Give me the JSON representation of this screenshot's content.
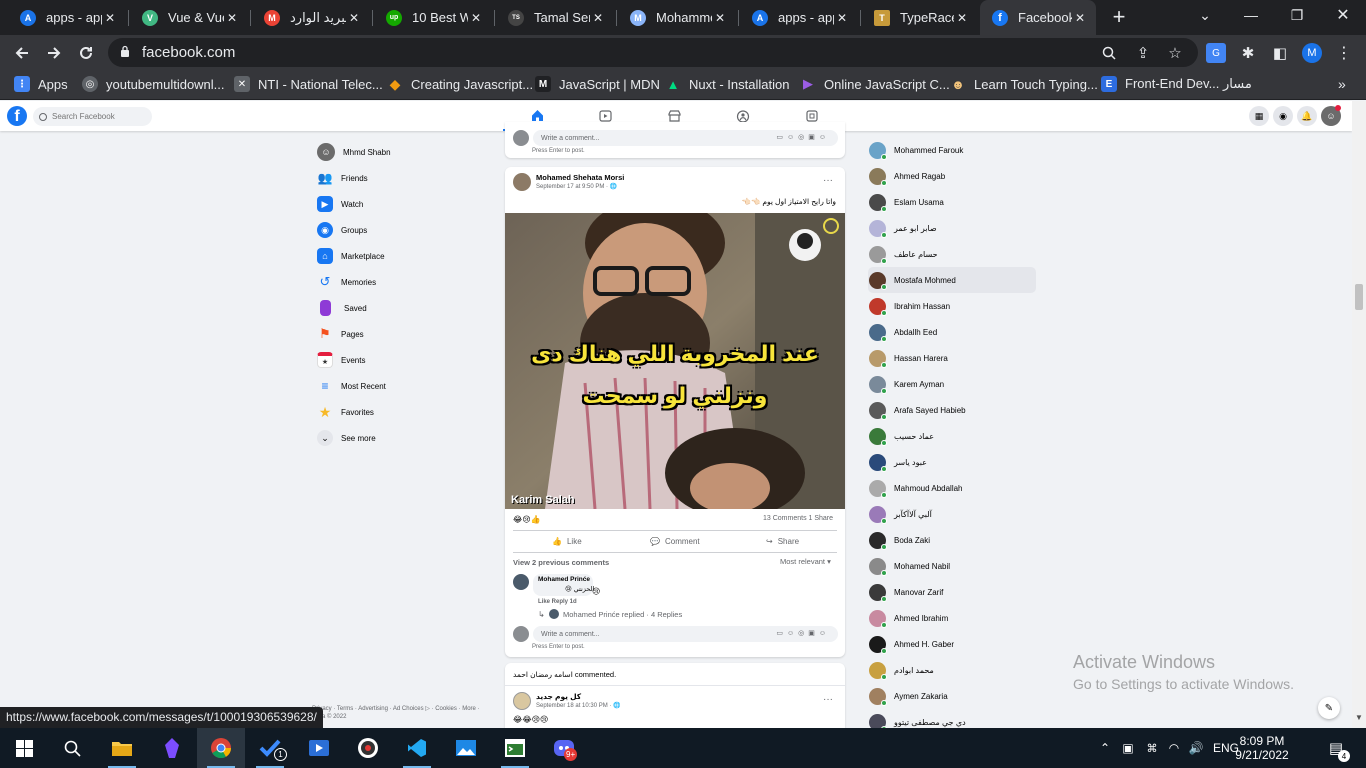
{
  "browser": {
    "tabs": [
      {
        "title": "apps - app",
        "color": "#1a73e8",
        "glyph": "A"
      },
      {
        "title": "Vue & Vue",
        "color": "#41b883",
        "glyph": "V"
      },
      {
        "title": "البريد الوارد",
        "color": "#ea4335",
        "glyph": "M"
      },
      {
        "title": "10 Best We",
        "color": "#14a800",
        "glyph": "up"
      },
      {
        "title": "Tamal Sen",
        "color": "#444444",
        "glyph": "TS"
      },
      {
        "title": "Mohamme",
        "color": "#8ab4f8",
        "glyph": "M"
      },
      {
        "title": "apps - app",
        "color": "#1a73e8",
        "glyph": "A"
      },
      {
        "title": "TypeRacer",
        "color": "#c79a3a",
        "glyph": "T"
      },
      {
        "title": "Facebook",
        "color": "#1877f2",
        "glyph": "f"
      }
    ],
    "url": "facebook.com",
    "profile_initial": "M",
    "bookmarks": [
      {
        "label": "Apps",
        "color": "#4285f4",
        "glyph": "⋮"
      },
      {
        "label": "youtubemultidownl...",
        "color": "#5f6368",
        "glyph": "◎"
      },
      {
        "label": "NTI - National Telec...",
        "color": "#5f6368",
        "glyph": "✕"
      },
      {
        "label": "Creating Javascript...",
        "color": "#f29b11",
        "glyph": "◆"
      },
      {
        "label": "JavaScript | MDN",
        "color": "#202124",
        "glyph": "M"
      },
      {
        "label": "Nuxt - Installation",
        "color": "#00dc82",
        "glyph": "▲"
      },
      {
        "label": "Online JavaScript C...",
        "color": "#7b2cbf",
        "glyph": "▶"
      },
      {
        "label": "Learn Touch Typing...",
        "color": "#d9534f",
        "glyph": "☻"
      },
      {
        "label": "Front-End Dev... مسار",
        "color": "#2d6cdf",
        "glyph": "E"
      }
    ],
    "status_url": "https://www.facebook.com/messages/t/100019306539628/"
  },
  "facebook": {
    "search_placeholder": "Search Facebook",
    "left_nav": [
      {
        "label": "Mhmd Shabn",
        "color": "#6b6b6b",
        "glyph": "☺",
        "round": true
      },
      {
        "label": "Friends",
        "color": "#1877f2",
        "glyph": "👥"
      },
      {
        "label": "Watch",
        "color": "#1877f2",
        "glyph": "▶"
      },
      {
        "label": "Groups",
        "color": "#1877f2",
        "glyph": "◉"
      },
      {
        "label": "Marketplace",
        "color": "#1877f2",
        "glyph": "⌂"
      },
      {
        "label": "Memories",
        "color": "#1877f2",
        "glyph": "↺"
      },
      {
        "label": "Saved",
        "color": "#8e3ad6",
        "glyph": "▮"
      },
      {
        "label": "Pages",
        "color": "#f4511e",
        "glyph": "⚑"
      },
      {
        "label": "Events",
        "color": "#e4e6eb",
        "glyph": "★"
      },
      {
        "label": "Most Recent",
        "color": "#1877f2",
        "glyph": "≡"
      },
      {
        "label": "Favorites",
        "color": "#f7b928",
        "glyph": "★"
      },
      {
        "label": "See more",
        "color": "#e4e6eb",
        "glyph": "⌄"
      }
    ],
    "footer": "Privacy · Terms · Advertising · Ad Choices ▷ · Cookies · More · Meta © 2022",
    "top_comment_placeholder": "Write a comment...",
    "press_enter": "Press Enter to post.",
    "post": {
      "author": "Mohamed Shehata Morsi",
      "time": "September 17 at 9:50 PM · 🌐",
      "text": "واتا رايح الامتياز اول يوم 👈🏻👈🏻",
      "meme_line1": "عند المخروبة اللي هناك دى",
      "meme_line2": "ونزلني لو سمحت",
      "watermark": "Karim Salah",
      "reactions": "😂😢👍",
      "counts": "13 Comments  1 Share",
      "like": "Like",
      "comment": "Comment",
      "share": "Share",
      "view_prev": "View 2 previous comments",
      "most_relevant": "Most relevant ▾",
      "reply_author": "Mohamed Prinće",
      "reply_text": "الحزنتي 😢",
      "reply_react": "😢",
      "reply_actions": "Like  Reply  1d",
      "replied": "Mohamed Prinće replied · 4 Replies",
      "comment_placeholder": "Write a comment..."
    },
    "next_post": {
      "commented": "اسامه رمضان احمد commented.",
      "title": "كل يوم جديد",
      "time": "September 18 at 10:30 PM · 🌐",
      "emojis": "😂😂😢😢"
    },
    "contacts": [
      {
        "name": "Mohammed Farouk",
        "color": "#6aa3c8"
      },
      {
        "name": "Ahmed Ragab",
        "color": "#8a7a5a"
      },
      {
        "name": "Eslam Usama",
        "color": "#4a4a4a"
      },
      {
        "name": "صابر ابو عمر",
        "color": "#b4b4d8"
      },
      {
        "name": "حسام عاطف",
        "color": "#9a9a9a"
      },
      {
        "name": "Mostafa Mohmed",
        "color": "#5a3a2a"
      },
      {
        "name": "Ibrahim Hassan",
        "color": "#c0392b"
      },
      {
        "name": "Abdallh Eed",
        "color": "#4a6a8a"
      },
      {
        "name": "Hassan Harera",
        "color": "#b89a6a"
      },
      {
        "name": "Karem Ayman",
        "color": "#7a8a9a"
      },
      {
        "name": "Arafa Sayed Habieb",
        "color": "#5a5a5a"
      },
      {
        "name": "عماد حسيب",
        "color": "#3a7a3a"
      },
      {
        "name": "عبود ياسر",
        "color": "#2a4a7a"
      },
      {
        "name": "Mahmoud Abdallah",
        "color": "#aaaaaa"
      },
      {
        "name": "آلبي آلاآكآبر",
        "color": "#9a7ab8"
      },
      {
        "name": "Boda Zaki",
        "color": "#2a2a2a"
      },
      {
        "name": "Mohamed Nabil",
        "color": "#8a8a8a"
      },
      {
        "name": "Manovar Zarif",
        "color": "#3a3a3a"
      },
      {
        "name": "Ahmed Ibrahim",
        "color": "#c88aa0"
      },
      {
        "name": "Ahmed H. Gaber",
        "color": "#1a1a1a"
      },
      {
        "name": "محمد ابوادم",
        "color": "#c8a040"
      },
      {
        "name": "Aymen Zakaria",
        "color": "#a08060"
      },
      {
        "name": "دي جي مصطفى تيتوو",
        "color": "#4a4a5a"
      }
    ]
  },
  "windows": {
    "activate_title": "Activate Windows",
    "activate_sub": "Go to Settings to activate Windows.",
    "lang": "ENG",
    "time": "8:09 PM",
    "date": "9/21/2022",
    "notif_count": "4",
    "todo_badge": "1",
    "discord_badge": "9+"
  }
}
